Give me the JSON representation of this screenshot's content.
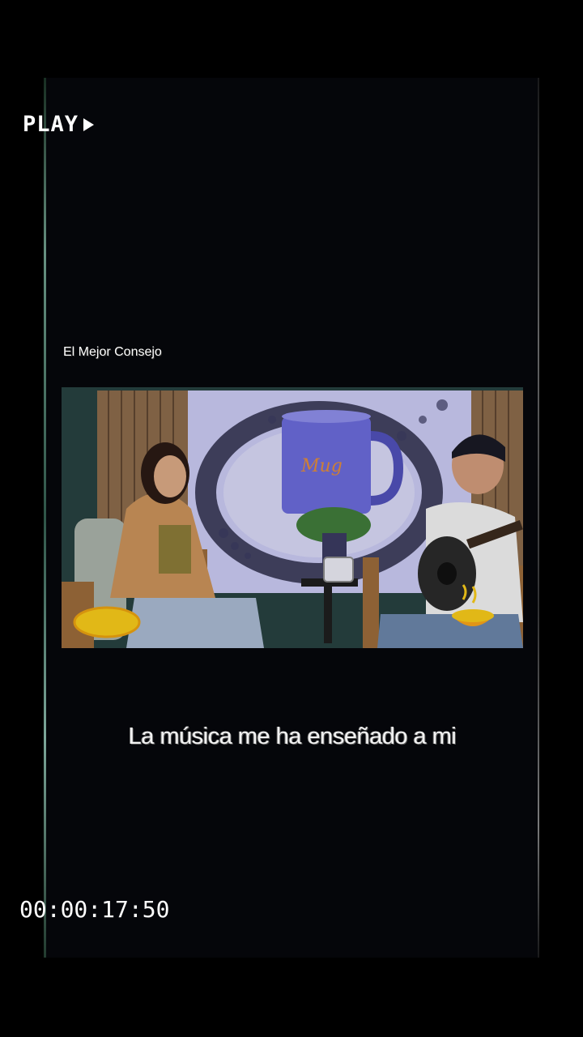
{
  "overlay": {
    "play_label": "PLAY",
    "play_icon": "play-triangle-icon",
    "timecode": "00:00:17:50"
  },
  "video": {
    "channel_name": "El Mejor Consejo",
    "caption": "La música me ha enseñado a mi",
    "colors": {
      "background": "#000000",
      "set_wall": "#c8c8f0",
      "mug": "#6a6ad8",
      "logo_badge": "#f5c81a"
    }
  }
}
